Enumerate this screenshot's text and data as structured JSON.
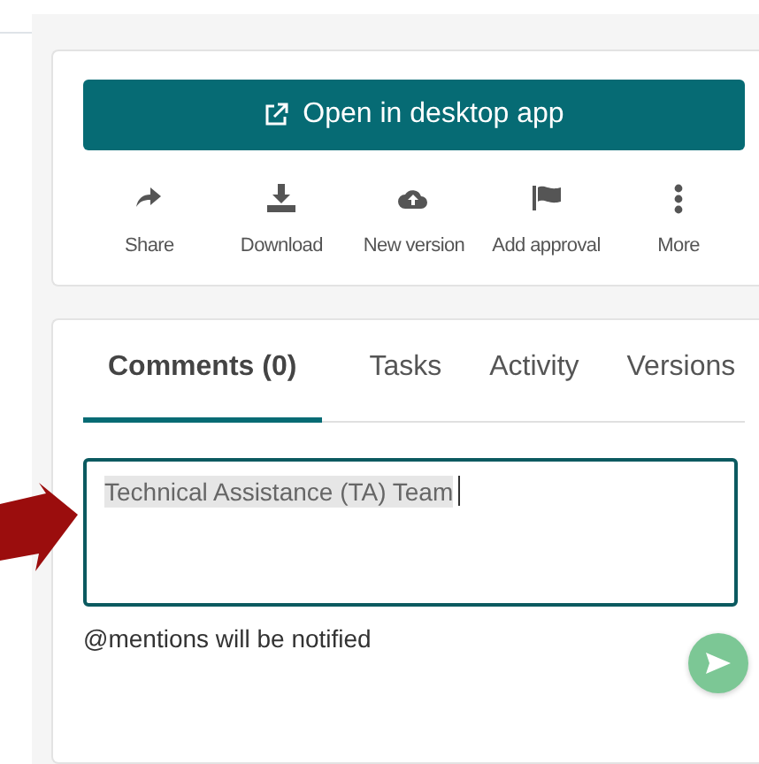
{
  "open_button": {
    "label": "Open in desktop app"
  },
  "actions": [
    {
      "kind": "share",
      "label": "Share"
    },
    {
      "kind": "download",
      "label": "Download"
    },
    {
      "kind": "upload",
      "label": "New version"
    },
    {
      "kind": "flag",
      "label": "Add approval"
    },
    {
      "kind": "more",
      "label": "More"
    }
  ],
  "tabs": [
    {
      "label": "Comments (0)",
      "selected": true
    },
    {
      "label": "Tasks",
      "selected": false
    },
    {
      "label": "Activity",
      "selected": false
    },
    {
      "label": "Versions",
      "selected": false
    }
  ],
  "comment": {
    "mention": "Technical Assistance (TA) Team",
    "focused": true
  },
  "hint": "@mentions will be notified"
}
